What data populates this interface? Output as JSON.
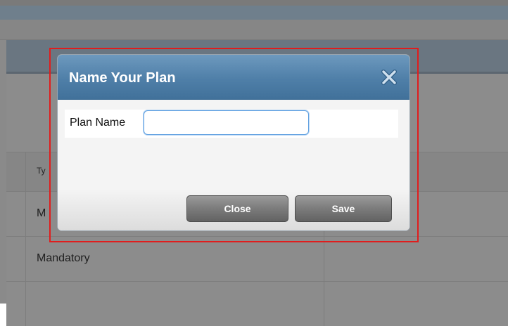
{
  "background": {
    "table_header_partial": "Ty",
    "rows": [
      {
        "type_partial": "M"
      },
      {
        "type": "Mandatory"
      }
    ]
  },
  "dialog": {
    "title": "Name Your Plan",
    "close_icon": "close-x-icon",
    "field_label": "Plan Name",
    "input_value": "",
    "input_placeholder": "",
    "close_button_label": "Close",
    "save_button_label": "Save"
  },
  "colors": {
    "dialog_header": "#4f7fa8",
    "highlight": "#e01d1d",
    "button": "#7e7e7e"
  }
}
